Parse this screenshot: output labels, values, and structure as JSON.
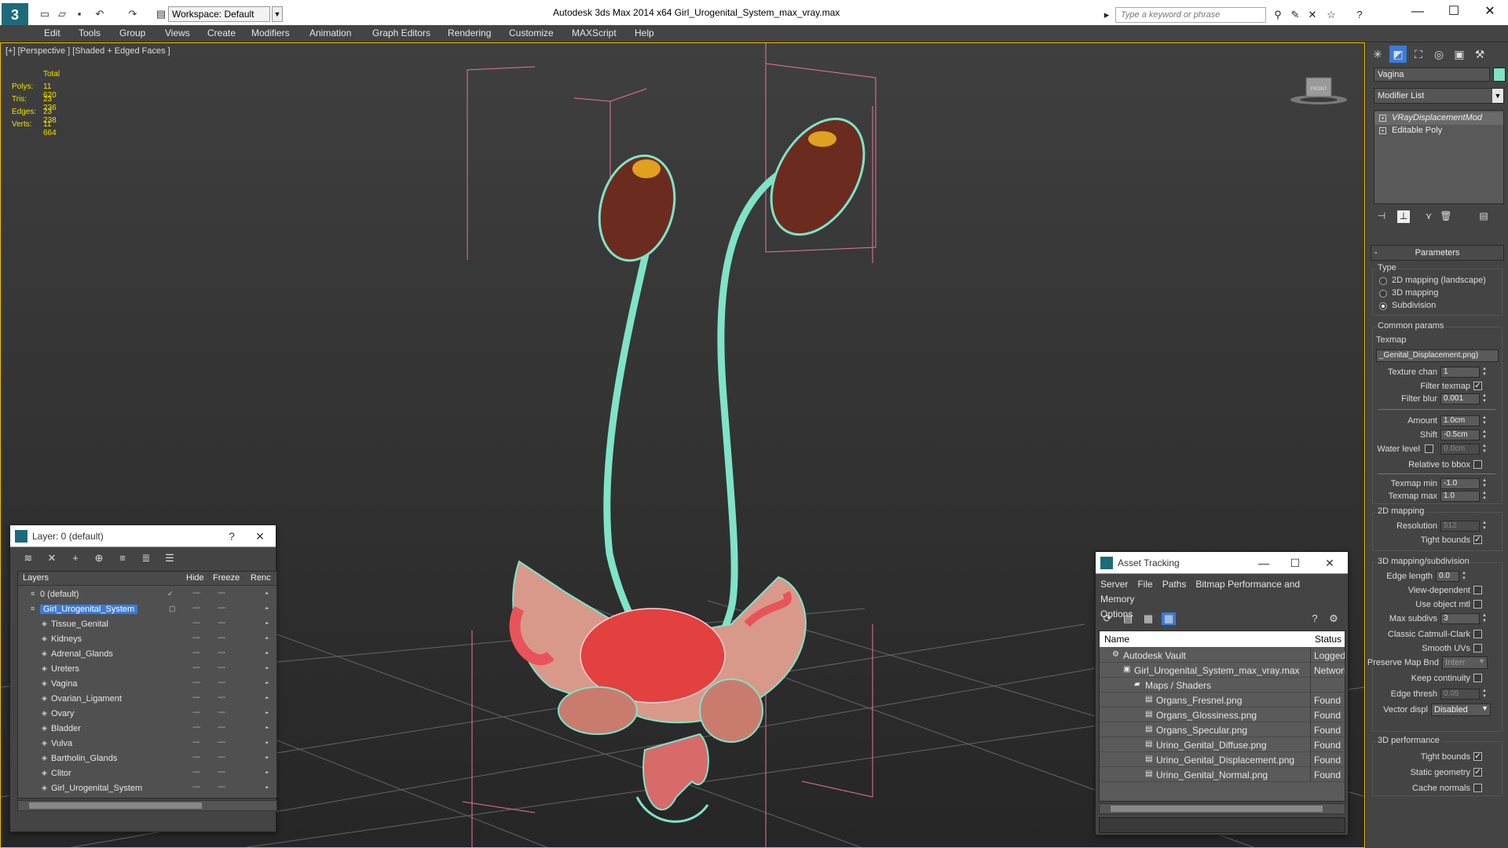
{
  "titlebar": {
    "title": "Autodesk 3ds Max  2014 x64     Girl_Urogenital_System_max_vray.max",
    "workspace": "Workspace: Default",
    "search_placeholder": "Type a keyword or phrase"
  },
  "menu": [
    "Edit",
    "Tools",
    "Group",
    "Views",
    "Create",
    "Modifiers",
    "Animation",
    "Graph Editors",
    "Rendering",
    "Customize",
    "MAXScript",
    "Help"
  ],
  "viewport": {
    "label": "[+] [Perspective ] [Shaded + Edged Faces ]",
    "stats_header": "Total",
    "stats": [
      {
        "k": "Polys:",
        "v": "11 620"
      },
      {
        "k": "Tris:",
        "v": "23 236"
      },
      {
        "k": "Edges:",
        "v": "23 238"
      },
      {
        "k": "Verts:",
        "v": "11 664"
      }
    ],
    "viewcube_label": "FRONT"
  },
  "layers": {
    "title": "Layer: 0 (default)",
    "help": "?",
    "columns": {
      "layers": "Layers",
      "hide": "Hide",
      "freeze": "Freeze",
      "render": "Renc"
    },
    "rows": [
      {
        "name": "0 (default)",
        "level": 1,
        "selected": false
      },
      {
        "name": "Girl_Urogenital_System",
        "level": 1,
        "selected": true
      },
      {
        "name": "Tissue_Genital",
        "level": 2,
        "selected": false
      },
      {
        "name": "Kidneys",
        "level": 2,
        "selected": false
      },
      {
        "name": "Adrenal_Glands",
        "level": 2,
        "selected": false
      },
      {
        "name": "Ureters",
        "level": 2,
        "selected": false
      },
      {
        "name": "Vagina",
        "level": 2,
        "selected": false
      },
      {
        "name": "Ovarian_Ligament",
        "level": 2,
        "selected": false
      },
      {
        "name": "Ovary",
        "level": 2,
        "selected": false
      },
      {
        "name": "Bladder",
        "level": 2,
        "selected": false
      },
      {
        "name": "Vulva",
        "level": 2,
        "selected": false
      },
      {
        "name": "Bartholin_Glands",
        "level": 2,
        "selected": false
      },
      {
        "name": "Clitor",
        "level": 2,
        "selected": false
      },
      {
        "name": "Girl_Urogenital_System",
        "level": 2,
        "selected": false
      }
    ]
  },
  "asset": {
    "title": "Asset Tracking",
    "menu": [
      "Server",
      "File",
      "Paths",
      "Bitmap Performance and Memory",
      "Options"
    ],
    "columns": {
      "name": "Name",
      "status": "Status"
    },
    "rows": [
      {
        "name": "Autodesk Vault",
        "status": "Logged",
        "indent": 1
      },
      {
        "name": "Girl_Urogenital_System_max_vray.max",
        "status": "Network",
        "indent": 2
      },
      {
        "name": "Maps / Shaders",
        "status": "",
        "indent": 3
      },
      {
        "name": "Organs_Fresnel.png",
        "status": "Found",
        "indent": 4
      },
      {
        "name": "Organs_Glossiness.png",
        "status": "Found",
        "indent": 4
      },
      {
        "name": "Organs_Specular.png",
        "status": "Found",
        "indent": 4
      },
      {
        "name": "Urino_Genital_Diffuse.png",
        "status": "Found",
        "indent": 4
      },
      {
        "name": "Urino_Genital_Displacement.png",
        "status": "Found",
        "indent": 4
      },
      {
        "name": "Urino_Genital_Normal.png",
        "status": "Found",
        "indent": 4
      }
    ]
  },
  "command": {
    "object_name": "Vagina",
    "object_color": "#7fe3c8",
    "modifier_list": "Modifier List",
    "stack": [
      "VRayDisplacementMod",
      "Editable Poly"
    ],
    "rollout": "Parameters",
    "type_label": "Type",
    "type_options": [
      "2D mapping (landscape)",
      "3D mapping",
      "Subdivision"
    ],
    "type_selected": 2,
    "common_label": "Common params",
    "texmap_label": "Texmap",
    "texmap_value": "_Genital_Displacement.png)",
    "texture_chan_label": "Texture chan",
    "texture_chan": "1",
    "filter_texmap_label": "Filter texmap",
    "filter_blur_label": "Filter blur",
    "filter_blur": "0.001",
    "amount_label": "Amount",
    "amount": "1.0cm",
    "shift_label": "Shift",
    "shift": "-0.5cm",
    "water_label": "Water level",
    "water": "0.0cm",
    "relbbox_label": "Relative to bbox",
    "texmin_label": "Texmap min",
    "texmin": "-1.0",
    "texmax_label": "Texmap max",
    "texmax": "1.0",
    "map2d_label": "2D mapping",
    "resolution_label": "Resolution",
    "resolution": "512",
    "tight1_label": "Tight bounds",
    "map3d_label": "3D mapping/subdivision",
    "edge_label": "Edge length",
    "edge": "0.0",
    "viewdep_label": "View-dependent",
    "useobj_label": "Use object mtl",
    "maxsub_label": "Max subdivs",
    "maxsub": "3",
    "catmull_label": "Classic Catmull-Clark",
    "smooth_label": "Smooth UVs",
    "preserve_label": "Preserve Map Bnd",
    "preserve": "Interr",
    "keepcont_label": "Keep continuity",
    "edgethresh_label": "Edge thresh",
    "edgethresh": "0.05",
    "vector_label": "Vector displ",
    "vector": "Disabled",
    "perf_label": "3D performance",
    "tight2_label": "Tight bounds",
    "static_label": "Static geometry",
    "cache_label": "Cache normals"
  }
}
